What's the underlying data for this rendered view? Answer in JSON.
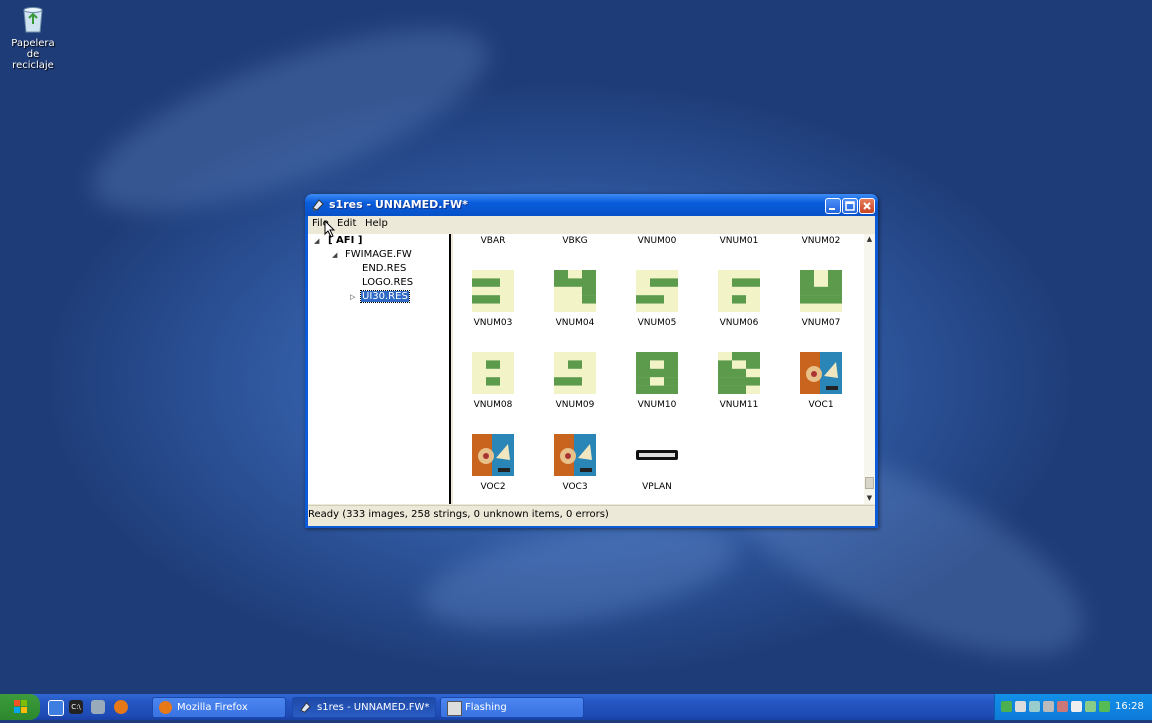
{
  "desktop": {
    "recycle_bin_label_line1": "Papelera de",
    "recycle_bin_label_line2": "reciclaje"
  },
  "window": {
    "title": "s1res - UNNAMED.FW*",
    "menu": [
      "File",
      "Edit",
      "Help"
    ],
    "tree": {
      "root": "[ AFI ]",
      "child": "FWIMAGE.FW",
      "leaves": [
        "END.RES",
        "LOGO.RES",
        "UI30.RES"
      ],
      "selected": "UI30.RES"
    },
    "items": [
      {
        "label": "VBAR",
        "icon": "blank"
      },
      {
        "label": "VBKG",
        "icon": "bar-strip"
      },
      {
        "label": "VNUM00",
        "icon": "num-partial"
      },
      {
        "label": "VNUM01",
        "icon": "num-partial-green"
      },
      {
        "label": "VNUM02",
        "icon": "num-partial"
      },
      {
        "label": "VNUM03",
        "icon": "digit-3"
      },
      {
        "label": "VNUM04",
        "icon": "digit-4"
      },
      {
        "label": "VNUM05",
        "icon": "digit-5"
      },
      {
        "label": "VNUM06",
        "icon": "digit-6"
      },
      {
        "label": "VNUM07",
        "icon": "digit-7"
      },
      {
        "label": "VNUM08",
        "icon": "digit-8"
      },
      {
        "label": "VNUM09",
        "icon": "digit-9"
      },
      {
        "label": "VNUM10",
        "icon": "digit-colon"
      },
      {
        "label": "VNUM11",
        "icon": "digit-slash"
      },
      {
        "label": "VOC1",
        "icon": "album-art"
      },
      {
        "label": "VOC2",
        "icon": "album-art"
      },
      {
        "label": "VOC3",
        "icon": "album-art"
      },
      {
        "label": "VPLAN",
        "icon": "plan-bar"
      }
    ],
    "status": "Ready (333 images, 258 strings, 0 unknown items, 0 errors)"
  },
  "taskbar": {
    "tasks": [
      {
        "label": "Mozilla Firefox",
        "icon": "firefox-icon",
        "active": false
      },
      {
        "label": "s1res - UNNAMED.FW*",
        "icon": "app-icon",
        "active": true
      },
      {
        "label": "Flashing",
        "icon": "window-icon",
        "active": false
      }
    ],
    "clock": "16:28"
  },
  "colors": {
    "digit_green": "#5c9a4c",
    "digit_bg": "#f3f3c8",
    "selection": "#316ac5",
    "titlebar": "#0a5cdc"
  }
}
